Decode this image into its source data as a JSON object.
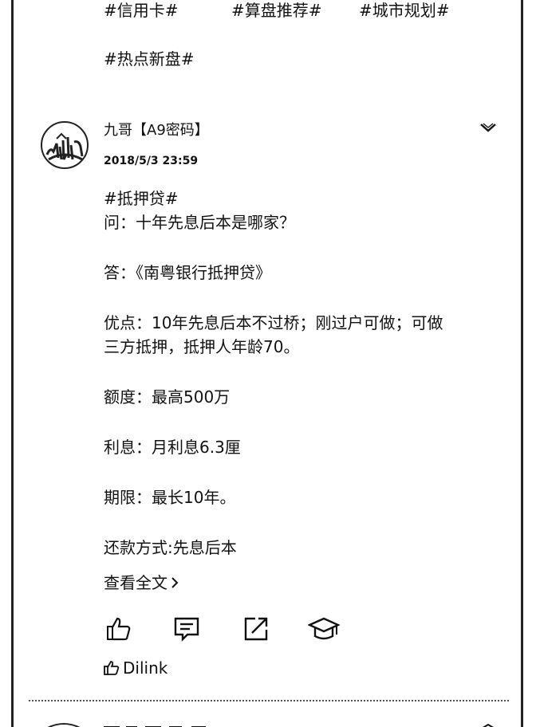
{
  "tags": {
    "row1": [
      "#信用卡#",
      "#算盘推荐#",
      "#城市规划#"
    ],
    "row2": "#热点新盘#"
  },
  "post": {
    "author": "九哥【A9密码】",
    "time": "2018/5/3 23:59",
    "lines": {
      "tag": "#抵押贷#",
      "question": "问：十年先息后本是哪家？",
      "answer": "答：《南粤银行抵押贷》",
      "advantage_1": "优点：10年先息后本不过桥；刚过户可做；可做",
      "advantage_2": "三方抵押，抵押人年龄70。",
      "amount": "额度：最高500万",
      "interest": "利息：月利息6.3厘",
      "term": "期限：最长10年。",
      "repayment": "还款方式:先息后本"
    },
    "read_more": "查看全文",
    "liked_by": "Dilink"
  },
  "icons": {
    "expand": "chevron-down-icon",
    "like": "thumbs-up-icon",
    "comment": "comment-icon",
    "share": "share-icon",
    "collect": "graduation-cap-icon"
  }
}
